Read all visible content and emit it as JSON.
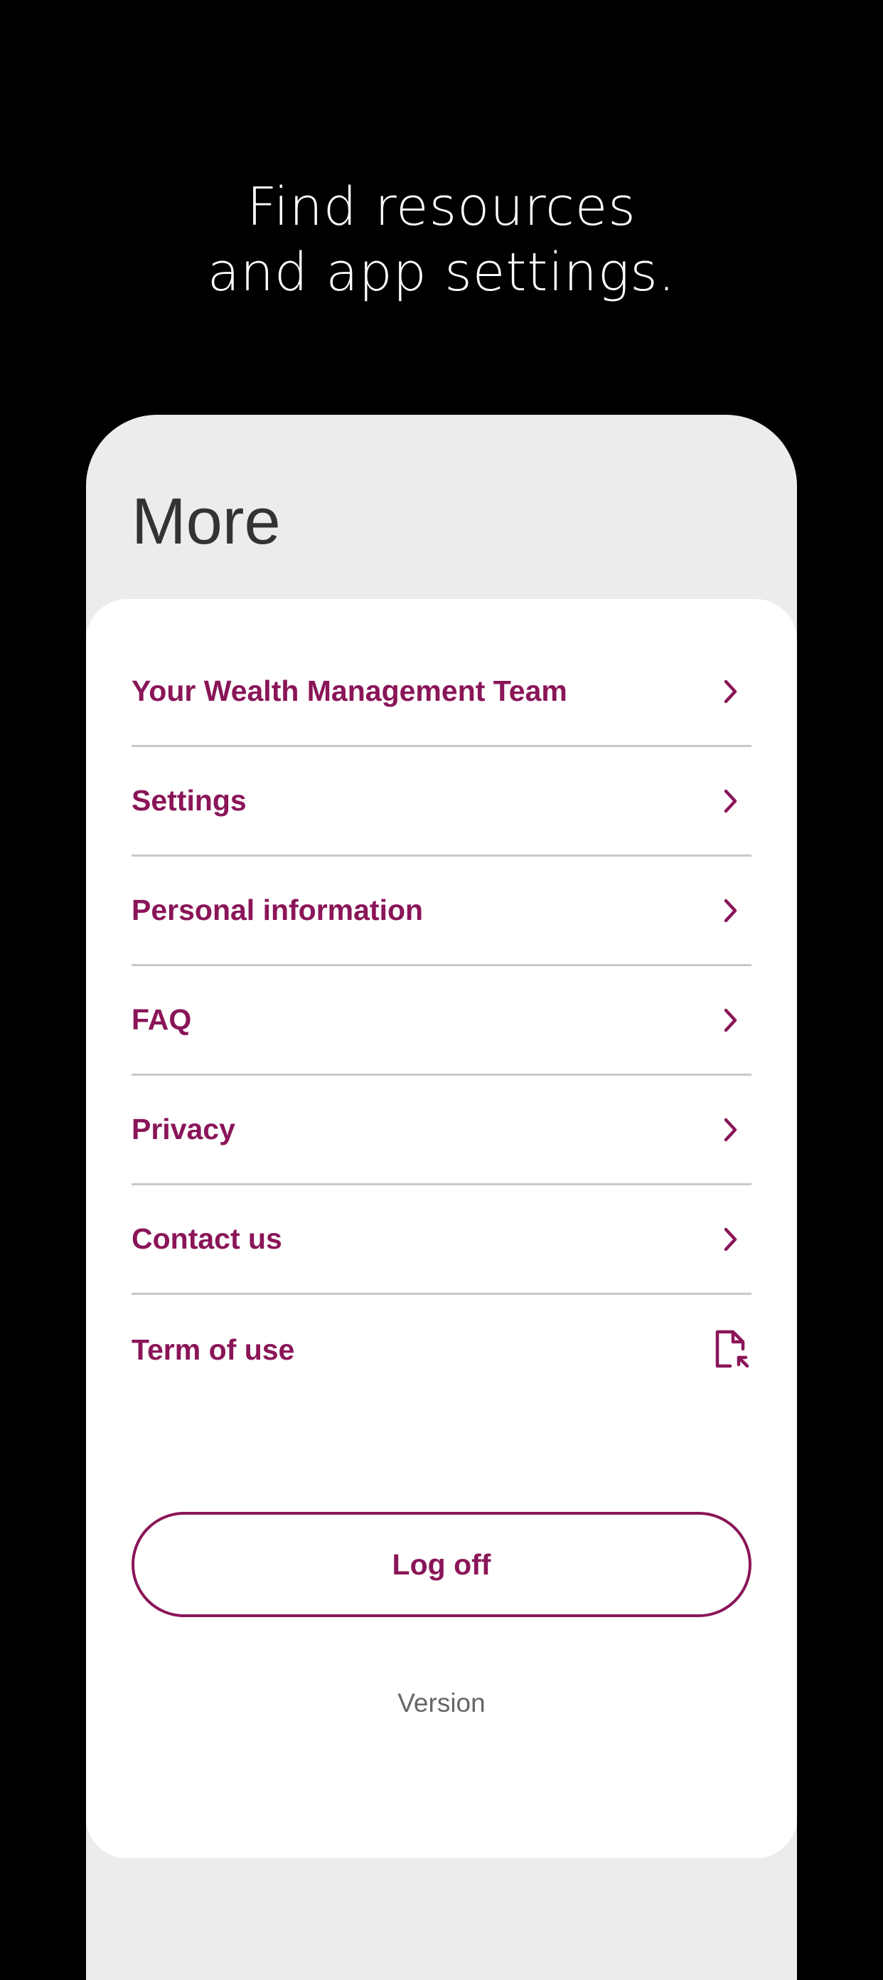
{
  "promo": {
    "headline_line1": "Find resources",
    "headline_line2": "and app settings."
  },
  "page": {
    "title": "More"
  },
  "menu": {
    "items": [
      {
        "label": "Your Wealth Management Team",
        "icon": "chevron-right-icon"
      },
      {
        "label": "Settings",
        "icon": "chevron-right-icon"
      },
      {
        "label": "Personal information",
        "icon": "chevron-right-icon"
      },
      {
        "label": "FAQ",
        "icon": "chevron-right-icon"
      },
      {
        "label": "Privacy",
        "icon": "chevron-right-icon"
      },
      {
        "label": "Contact us",
        "icon": "chevron-right-icon"
      },
      {
        "label": "Term of use",
        "icon": "external-document-icon"
      }
    ]
  },
  "actions": {
    "logoff_label": "Log off"
  },
  "footer": {
    "version_label": "Version"
  },
  "colors": {
    "background": "#000000",
    "screen_background": "#edeceb",
    "card_background": "#ffffff",
    "accent": "#8a1558",
    "divider": "#c9c8ce",
    "title_text": "#333333",
    "muted_text": "#666666"
  }
}
